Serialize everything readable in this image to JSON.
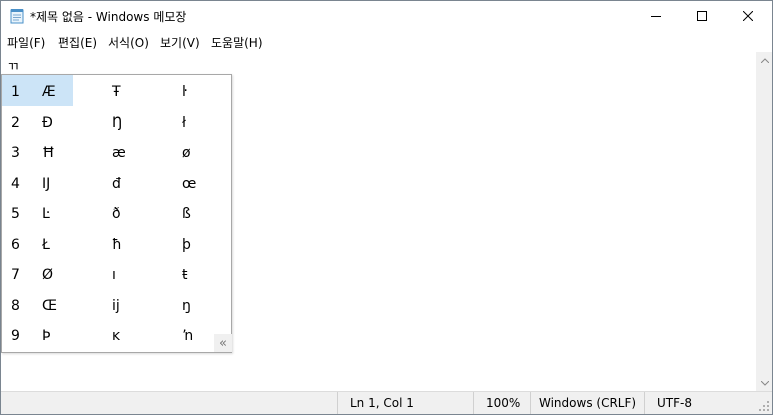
{
  "window": {
    "title": "*제목 없음 - Windows 메모장"
  },
  "caption": {
    "minimize": "minimize",
    "maximize": "maximize",
    "close": "close"
  },
  "menu": {
    "items": [
      {
        "label": "파일(F)"
      },
      {
        "label": "편집(E)"
      },
      {
        "label": "서식(O)"
      },
      {
        "label": "보기(V)"
      },
      {
        "label": "도움말(H)"
      }
    ]
  },
  "editor": {
    "content": "ㄲ"
  },
  "ime": {
    "selected_index": 0,
    "rows": [
      {
        "num": "1",
        "cols": [
          "Æ",
          "Ŧ",
          "ŀ"
        ]
      },
      {
        "num": "2",
        "cols": [
          "Ð",
          "Ŋ",
          "ł"
        ]
      },
      {
        "num": "3",
        "cols": [
          "Ħ",
          "æ",
          "ø"
        ]
      },
      {
        "num": "4",
        "cols": [
          "Ĳ",
          "đ",
          "œ"
        ]
      },
      {
        "num": "5",
        "cols": [
          "Ŀ",
          "ð",
          "ß"
        ]
      },
      {
        "num": "6",
        "cols": [
          "Ł",
          "ħ",
          "þ"
        ]
      },
      {
        "num": "7",
        "cols": [
          "Ø",
          "ı",
          "ŧ"
        ]
      },
      {
        "num": "8",
        "cols": [
          "Œ",
          "ĳ",
          "ŋ"
        ]
      },
      {
        "num": "9",
        "cols": [
          "Þ",
          "ĸ",
          "ŉ"
        ]
      }
    ],
    "expand_glyph": "«"
  },
  "status": {
    "position": "Ln 1, Col 1",
    "zoom": "100%",
    "line_ending": "Windows (CRLF)",
    "encoding": "UTF-8"
  },
  "colors": {
    "highlight": "#cce4f7",
    "statusbar": "#f0f0f0"
  }
}
